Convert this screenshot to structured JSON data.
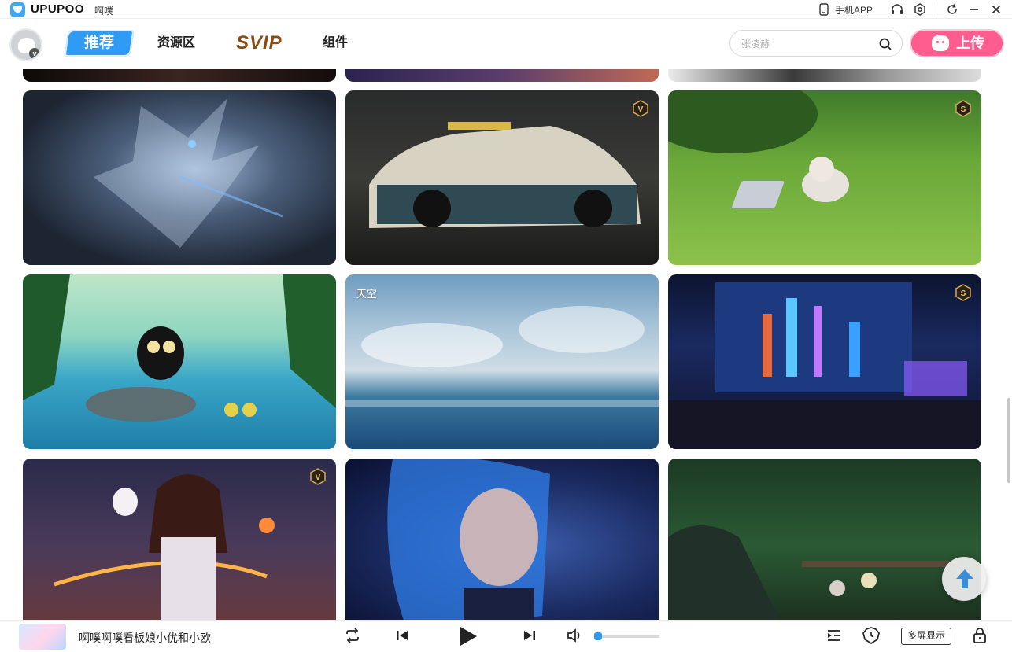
{
  "titlebar": {
    "brand": "UPUPOO",
    "title": "啊噗",
    "mobile_app": "手机APP"
  },
  "nav": {
    "tabs": [
      {
        "label": "推荐",
        "active": true
      },
      {
        "label": "资源区",
        "active": false
      },
      {
        "label": "SVIP",
        "active": false
      },
      {
        "label": "组件",
        "active": false
      }
    ],
    "search_placeholder": "张凌赫",
    "upload_label": "上传"
  },
  "cards": [
    {
      "badge": "",
      "caption": ""
    },
    {
      "badge": "",
      "caption": ""
    },
    {
      "badge": "",
      "caption": ""
    },
    {
      "badge": "",
      "caption": ""
    },
    {
      "badge": "V",
      "caption": ""
    },
    {
      "badge": "S",
      "caption": ""
    },
    {
      "badge": "",
      "caption": ""
    },
    {
      "badge": "",
      "caption": "天空"
    },
    {
      "badge": "S",
      "caption": ""
    },
    {
      "badge": "V",
      "caption": ""
    },
    {
      "badge": "",
      "caption": ""
    },
    {
      "badge": "",
      "caption": ""
    }
  ],
  "player": {
    "track_title": "啊噗啊噗看板娘小优和小欧",
    "volume": 0.02,
    "multi_screen_label": "多屏显示"
  },
  "colors": {
    "accent": "#2f9bf4",
    "upload": "#ff5c8f",
    "svip": "#8a4a14"
  }
}
